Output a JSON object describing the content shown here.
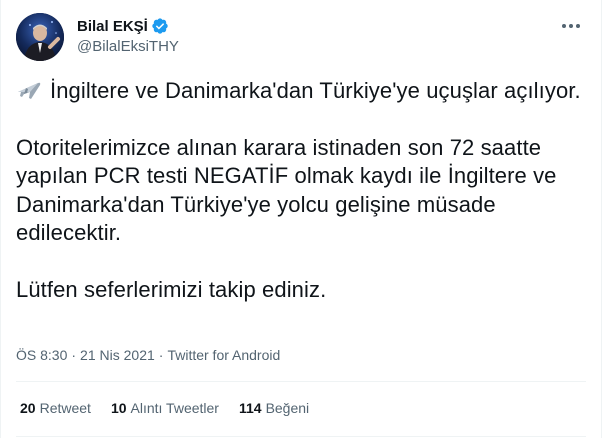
{
  "author": {
    "display_name": "Bilal EKŞİ",
    "handle": "@BilalEksiTHY",
    "verified": true
  },
  "tweet": {
    "emoji": "airplane-icon",
    "paragraphs": [
      "İngiltere ve Danimarka'dan Türkiye'ye uçuşlar açılıyor.",
      "Otoritelerimizce alınan karara istinaden  son 72 saatte yapılan PCR testi NEGATİF olmak kaydı ile İngiltere ve Danimarka'dan Türkiye'ye yolcu gelişine müsade edilecektir.",
      "Lütfen seferlerimizi takip ediniz."
    ]
  },
  "meta": {
    "time": "ÖS 8:30",
    "date": "21 Nis 2021",
    "source": "Twitter for Android",
    "separator": "·"
  },
  "stats": {
    "retweets": {
      "count": "20",
      "label": "Retweet"
    },
    "quotes": {
      "count": "10",
      "label": "Alıntı Tweetler"
    },
    "likes": {
      "count": "114",
      "label": "Beğeni"
    }
  },
  "colors": {
    "verified": "#1d9bf0",
    "secondary_text": "#536471",
    "primary_text": "#0f1419",
    "divider": "#eff3f4"
  }
}
